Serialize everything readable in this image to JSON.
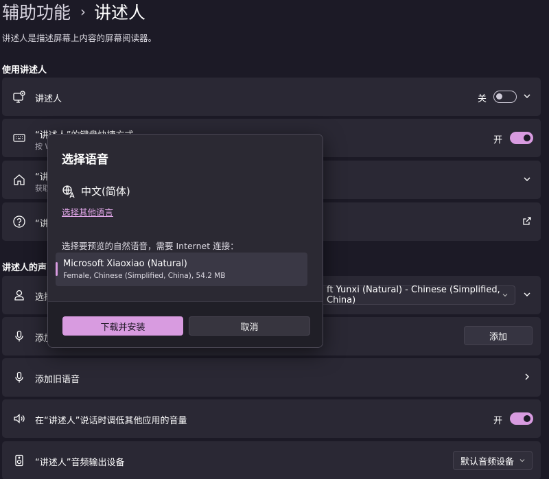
{
  "breadcrumb": {
    "parent": "辅助功能",
    "separator": "›",
    "current": "讲述人"
  },
  "description": "讲述人是描述屏幕上内容的屏幕阅读器。",
  "sections": {
    "use": "使用讲述人",
    "voice": "讲述人的声"
  },
  "cards": {
    "narrator": {
      "label": "讲述人",
      "state": "关",
      "toggle": false
    },
    "shortcut": {
      "label": "“讲述人”的键盘快捷方式",
      "sub": "按 W",
      "state": "开",
      "toggle": true
    },
    "home": {
      "label": "“讲",
      "sub": "获取"
    },
    "help": {
      "label": "“讲"
    },
    "voice": {
      "label": "选择",
      "select_value": "ft Yunxi (Natural) - Chinese (Simplified, China)"
    },
    "add_natural": {
      "label": "添加",
      "button": "添加"
    },
    "add_legacy": {
      "label": "添加旧语音"
    },
    "lower_volume": {
      "label": "在“讲述人”说话时调低其他应用的音量",
      "state": "开",
      "toggle": true
    },
    "audio_output": {
      "label": "“讲述人”音频输出设备",
      "select_value": "默认音频设备"
    }
  },
  "dialog": {
    "title": "选择语音",
    "language": "中文(简体)",
    "other_language_link": "选择其他语言",
    "prompt": "选择要预览的自然语音，需要 Internet 连接：",
    "voice": {
      "name": "Microsoft Xiaoxiao (Natural)",
      "detail": "Female,  Chinese (Simplified, China), 54.2 MB"
    },
    "primary_button": "下载并安装",
    "cancel_button": "取消"
  },
  "colors": {
    "accent": "#d89be0",
    "background": "#1c1a26",
    "card": "#2a2834"
  },
  "icons": [
    "narrator-icon",
    "keyboard-icon",
    "home-icon",
    "help-icon",
    "person-icon",
    "microphone-icon",
    "speaker-icon",
    "audio-device-icon",
    "language-icon",
    "chevron-down-icon",
    "chevron-right-icon",
    "external-link-icon"
  ]
}
